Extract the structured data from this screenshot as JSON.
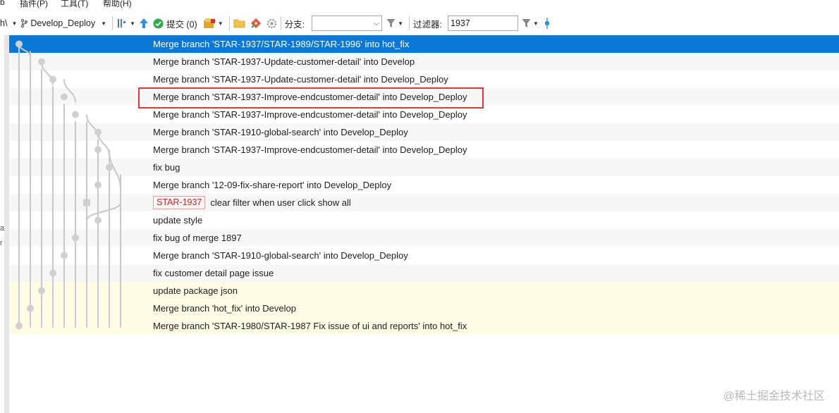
{
  "menu": [
    "b",
    "插件(P)",
    "工具(T)",
    "帮助(H)"
  ],
  "toolbar": {
    "path_fragment": "h\\",
    "branch": "Develop_Deploy",
    "commit_label": "提交 (0)",
    "branch_label": "分支:",
    "branch_value": "",
    "filter_label": "过滤器:",
    "filter_value": "1937"
  },
  "left_edge_chars": [
    "a",
    "r"
  ],
  "commits": [
    {
      "message": "Merge branch 'STAR-1937/STAR-1989/STAR-1996' into hot_fix",
      "selected": true
    },
    {
      "message": "Merge branch 'STAR-1937-Update-customer-detail' into Develop"
    },
    {
      "message": "Merge branch 'STAR-1937-Update-customer-detail' into Develop_Deploy"
    },
    {
      "message": "Merge branch 'STAR-1937-Improve-endcustomer-detail' into Develop_Deploy",
      "highlighted": true
    },
    {
      "message": "Merge branch 'STAR-1937-Improve-endcustomer-detail' into Develop_Deploy"
    },
    {
      "message": "Merge branch 'STAR-1910-global-search' into Develop_Deploy"
    },
    {
      "message": "Merge branch 'STAR-1937-Improve-endcustomer-detail' into Develop_Deploy"
    },
    {
      "message": "fix bug"
    },
    {
      "message": "Merge branch '12-09-fix-share-report' into Develop_Deploy"
    },
    {
      "message": "clear filter when user click show all",
      "tag": "STAR-1937"
    },
    {
      "message": "update style"
    },
    {
      "message": "fix bug of merge 1897"
    },
    {
      "message": "Merge branch 'STAR-1910-global-search' into Develop_Deploy"
    },
    {
      "message": "fix customer detail page issue"
    },
    {
      "message": "update package json",
      "yellow": true
    },
    {
      "message": "Merge branch 'hot_fix' into Develop",
      "yellow": true
    },
    {
      "message": "Merge branch 'STAR-1980/STAR-1987 Fix issue of ui and reports' into hot_fix",
      "yellow": true
    }
  ],
  "watermark": "@稀土掘金技术社区",
  "colors": {
    "selected_row": "#0a78d7",
    "highlight_border": "#e0373a",
    "graph_line": "#c8c8c8",
    "tag_text": "#b42a2a"
  }
}
